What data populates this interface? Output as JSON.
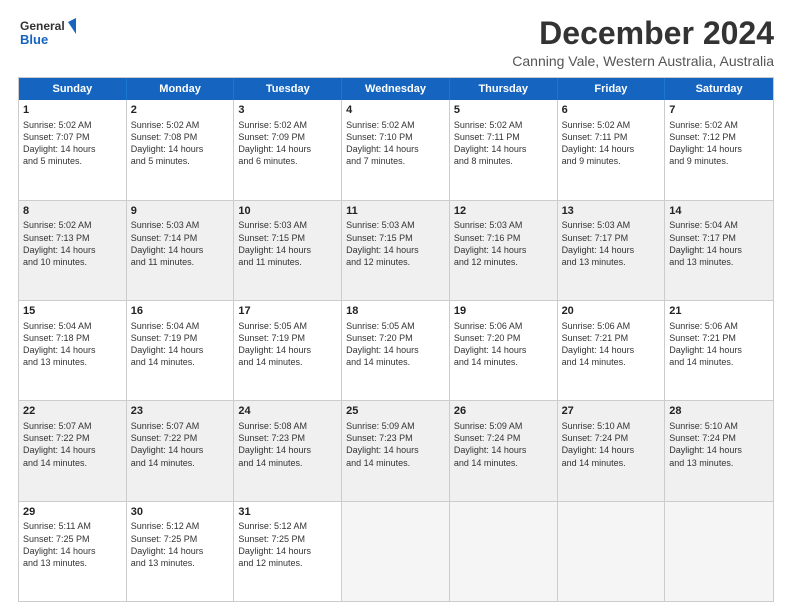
{
  "logo": {
    "line1": "General",
    "line2": "Blue"
  },
  "title": "December 2024",
  "subtitle": "Canning Vale, Western Australia, Australia",
  "header_days": [
    "Sunday",
    "Monday",
    "Tuesday",
    "Wednesday",
    "Thursday",
    "Friday",
    "Saturday"
  ],
  "rows": [
    [
      {
        "day": "1",
        "lines": [
          "Sunrise: 5:02 AM",
          "Sunset: 7:07 PM",
          "Daylight: 14 hours",
          "and 5 minutes."
        ]
      },
      {
        "day": "2",
        "lines": [
          "Sunrise: 5:02 AM",
          "Sunset: 7:08 PM",
          "Daylight: 14 hours",
          "and 5 minutes."
        ]
      },
      {
        "day": "3",
        "lines": [
          "Sunrise: 5:02 AM",
          "Sunset: 7:09 PM",
          "Daylight: 14 hours",
          "and 6 minutes."
        ]
      },
      {
        "day": "4",
        "lines": [
          "Sunrise: 5:02 AM",
          "Sunset: 7:10 PM",
          "Daylight: 14 hours",
          "and 7 minutes."
        ]
      },
      {
        "day": "5",
        "lines": [
          "Sunrise: 5:02 AM",
          "Sunset: 7:11 PM",
          "Daylight: 14 hours",
          "and 8 minutes."
        ]
      },
      {
        "day": "6",
        "lines": [
          "Sunrise: 5:02 AM",
          "Sunset: 7:11 PM",
          "Daylight: 14 hours",
          "and 9 minutes."
        ]
      },
      {
        "day": "7",
        "lines": [
          "Sunrise: 5:02 AM",
          "Sunset: 7:12 PM",
          "Daylight: 14 hours",
          "and 9 minutes."
        ]
      }
    ],
    [
      {
        "day": "8",
        "lines": [
          "Sunrise: 5:02 AM",
          "Sunset: 7:13 PM",
          "Daylight: 14 hours",
          "and 10 minutes."
        ]
      },
      {
        "day": "9",
        "lines": [
          "Sunrise: 5:03 AM",
          "Sunset: 7:14 PM",
          "Daylight: 14 hours",
          "and 11 minutes."
        ]
      },
      {
        "day": "10",
        "lines": [
          "Sunrise: 5:03 AM",
          "Sunset: 7:15 PM",
          "Daylight: 14 hours",
          "and 11 minutes."
        ]
      },
      {
        "day": "11",
        "lines": [
          "Sunrise: 5:03 AM",
          "Sunset: 7:15 PM",
          "Daylight: 14 hours",
          "and 12 minutes."
        ]
      },
      {
        "day": "12",
        "lines": [
          "Sunrise: 5:03 AM",
          "Sunset: 7:16 PM",
          "Daylight: 14 hours",
          "and 12 minutes."
        ]
      },
      {
        "day": "13",
        "lines": [
          "Sunrise: 5:03 AM",
          "Sunset: 7:17 PM",
          "Daylight: 14 hours",
          "and 13 minutes."
        ]
      },
      {
        "day": "14",
        "lines": [
          "Sunrise: 5:04 AM",
          "Sunset: 7:17 PM",
          "Daylight: 14 hours",
          "and 13 minutes."
        ]
      }
    ],
    [
      {
        "day": "15",
        "lines": [
          "Sunrise: 5:04 AM",
          "Sunset: 7:18 PM",
          "Daylight: 14 hours",
          "and 13 minutes."
        ]
      },
      {
        "day": "16",
        "lines": [
          "Sunrise: 5:04 AM",
          "Sunset: 7:19 PM",
          "Daylight: 14 hours",
          "and 14 minutes."
        ]
      },
      {
        "day": "17",
        "lines": [
          "Sunrise: 5:05 AM",
          "Sunset: 7:19 PM",
          "Daylight: 14 hours",
          "and 14 minutes."
        ]
      },
      {
        "day": "18",
        "lines": [
          "Sunrise: 5:05 AM",
          "Sunset: 7:20 PM",
          "Daylight: 14 hours",
          "and 14 minutes."
        ]
      },
      {
        "day": "19",
        "lines": [
          "Sunrise: 5:06 AM",
          "Sunset: 7:20 PM",
          "Daylight: 14 hours",
          "and 14 minutes."
        ]
      },
      {
        "day": "20",
        "lines": [
          "Sunrise: 5:06 AM",
          "Sunset: 7:21 PM",
          "Daylight: 14 hours",
          "and 14 minutes."
        ]
      },
      {
        "day": "21",
        "lines": [
          "Sunrise: 5:06 AM",
          "Sunset: 7:21 PM",
          "Daylight: 14 hours",
          "and 14 minutes."
        ]
      }
    ],
    [
      {
        "day": "22",
        "lines": [
          "Sunrise: 5:07 AM",
          "Sunset: 7:22 PM",
          "Daylight: 14 hours",
          "and 14 minutes."
        ]
      },
      {
        "day": "23",
        "lines": [
          "Sunrise: 5:07 AM",
          "Sunset: 7:22 PM",
          "Daylight: 14 hours",
          "and 14 minutes."
        ]
      },
      {
        "day": "24",
        "lines": [
          "Sunrise: 5:08 AM",
          "Sunset: 7:23 PM",
          "Daylight: 14 hours",
          "and 14 minutes."
        ]
      },
      {
        "day": "25",
        "lines": [
          "Sunrise: 5:09 AM",
          "Sunset: 7:23 PM",
          "Daylight: 14 hours",
          "and 14 minutes."
        ]
      },
      {
        "day": "26",
        "lines": [
          "Sunrise: 5:09 AM",
          "Sunset: 7:24 PM",
          "Daylight: 14 hours",
          "and 14 minutes."
        ]
      },
      {
        "day": "27",
        "lines": [
          "Sunrise: 5:10 AM",
          "Sunset: 7:24 PM",
          "Daylight: 14 hours",
          "and 14 minutes."
        ]
      },
      {
        "day": "28",
        "lines": [
          "Sunrise: 5:10 AM",
          "Sunset: 7:24 PM",
          "Daylight: 14 hours",
          "and 13 minutes."
        ]
      }
    ],
    [
      {
        "day": "29",
        "lines": [
          "Sunrise: 5:11 AM",
          "Sunset: 7:25 PM",
          "Daylight: 14 hours",
          "and 13 minutes."
        ]
      },
      {
        "day": "30",
        "lines": [
          "Sunrise: 5:12 AM",
          "Sunset: 7:25 PM",
          "Daylight: 14 hours",
          "and 13 minutes."
        ]
      },
      {
        "day": "31",
        "lines": [
          "Sunrise: 5:12 AM",
          "Sunset: 7:25 PM",
          "Daylight: 14 hours",
          "and 12 minutes."
        ]
      },
      null,
      null,
      null,
      null
    ]
  ]
}
